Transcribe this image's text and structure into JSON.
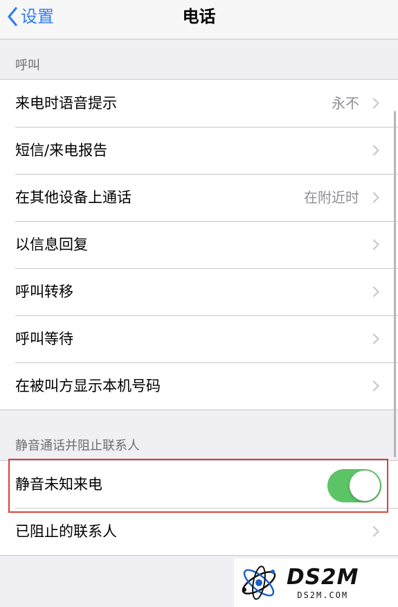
{
  "navbar": {
    "back_label": "设置",
    "title": "电话"
  },
  "sections": [
    {
      "header": "呼叫",
      "rows": [
        {
          "label": "来电时语音提示",
          "value": "永不"
        },
        {
          "label": "短信/来电报告",
          "value": ""
        },
        {
          "label": "在其他设备上通话",
          "value": "在附近时"
        },
        {
          "label": "以信息回复",
          "value": ""
        },
        {
          "label": "呼叫转移",
          "value": ""
        },
        {
          "label": "呼叫等待",
          "value": ""
        },
        {
          "label": "在被叫方显示本机号码",
          "value": ""
        }
      ]
    },
    {
      "header": "静音通话并阻止联系人",
      "toggle_row": {
        "label": "静音未知来电",
        "state": "on"
      },
      "rows": [
        {
          "label": "已阻止的联系人",
          "value": ""
        }
      ]
    }
  ],
  "watermark": {
    "main": "DS2M",
    "sub": "DS2M.COM"
  },
  "colors": {
    "accent": "#2f7cf6",
    "toggle_on": "#5cc466",
    "highlight": "#d9403b",
    "background": "#efeff4"
  },
  "icons": [
    "back-chevron-icon",
    "chevron-right-icon",
    "atom-logo-icon"
  ]
}
